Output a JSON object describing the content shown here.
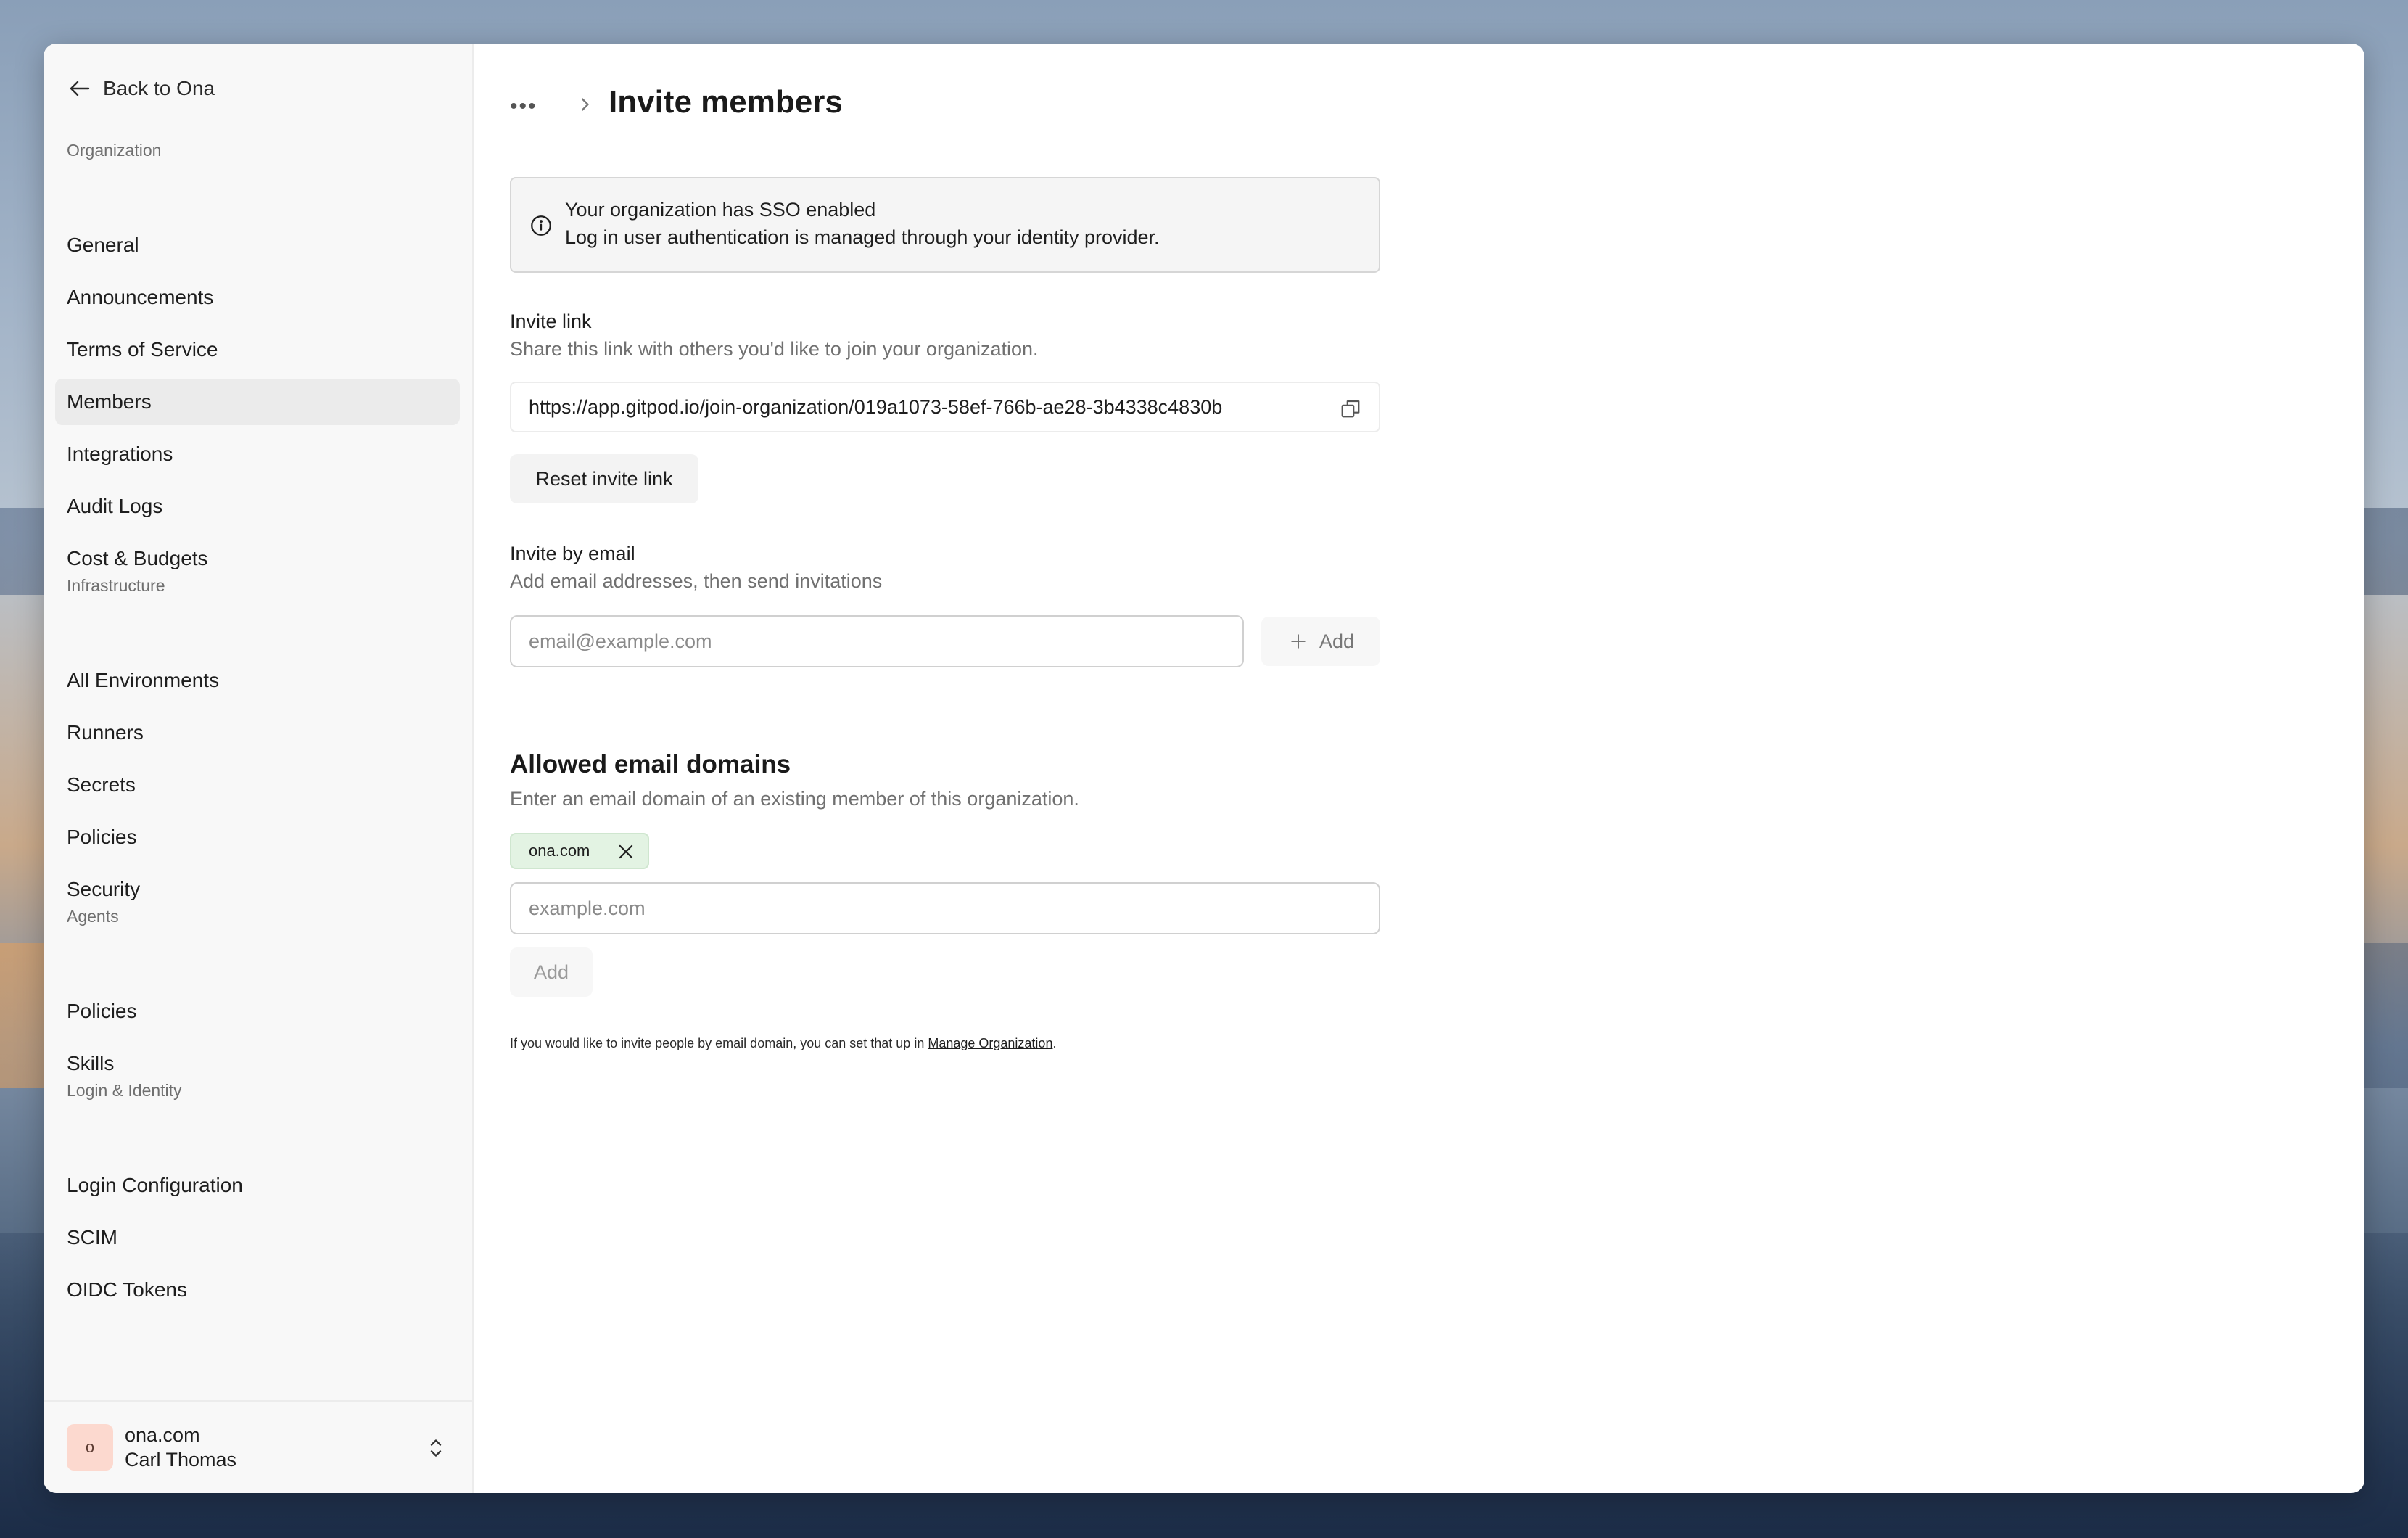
{
  "sidebar": {
    "back_label": "Back to Ona",
    "sections": [
      {
        "label": "Organization",
        "items": [
          "General",
          "Announcements",
          "Terms of Service",
          "Members",
          "Integrations",
          "Audit Logs",
          "Cost & Budgets"
        ]
      },
      {
        "label": "Infrastructure",
        "items": [
          "All Environments",
          "Runners",
          "Secrets",
          "Policies",
          "Security"
        ]
      },
      {
        "label": "Agents",
        "items": [
          "Policies",
          "Skills"
        ]
      },
      {
        "label": "Login & Identity",
        "items": [
          "Login Configuration",
          "SCIM",
          "OIDC Tokens"
        ]
      }
    ],
    "active_item": "Members",
    "footer": {
      "avatar_letter": "o",
      "org_name": "ona.com",
      "user_name": "Carl Thomas"
    }
  },
  "header": {
    "breadcrumb_more": "•••",
    "title": "Invite members"
  },
  "sso_alert": {
    "title": "Your organization has SSO enabled",
    "text": "Log in user authentication is managed through your identity provider."
  },
  "invite_link": {
    "label": "Invite link",
    "helper": "Share this link with others you'd like to join your organization.",
    "url": "https://app.gitpod.io/join-organization/019a1073-58ef-766b-ae28-3b4338c4830b",
    "reset_label": "Reset invite link"
  },
  "invite_email": {
    "label": "Invite by email",
    "helper": "Add email addresses, then send invitations",
    "placeholder": "email@example.com",
    "add_label": "Add"
  },
  "allowed_domains": {
    "heading": "Allowed email domains",
    "helper": "Enter an email domain of an existing member of this organization.",
    "chips": [
      "ona.com"
    ],
    "placeholder": "example.com",
    "add_label": "Add"
  },
  "footnote": {
    "text": "If you would like to invite people by email domain, you can set that up in ",
    "link": "Manage Organization",
    "end": "."
  }
}
